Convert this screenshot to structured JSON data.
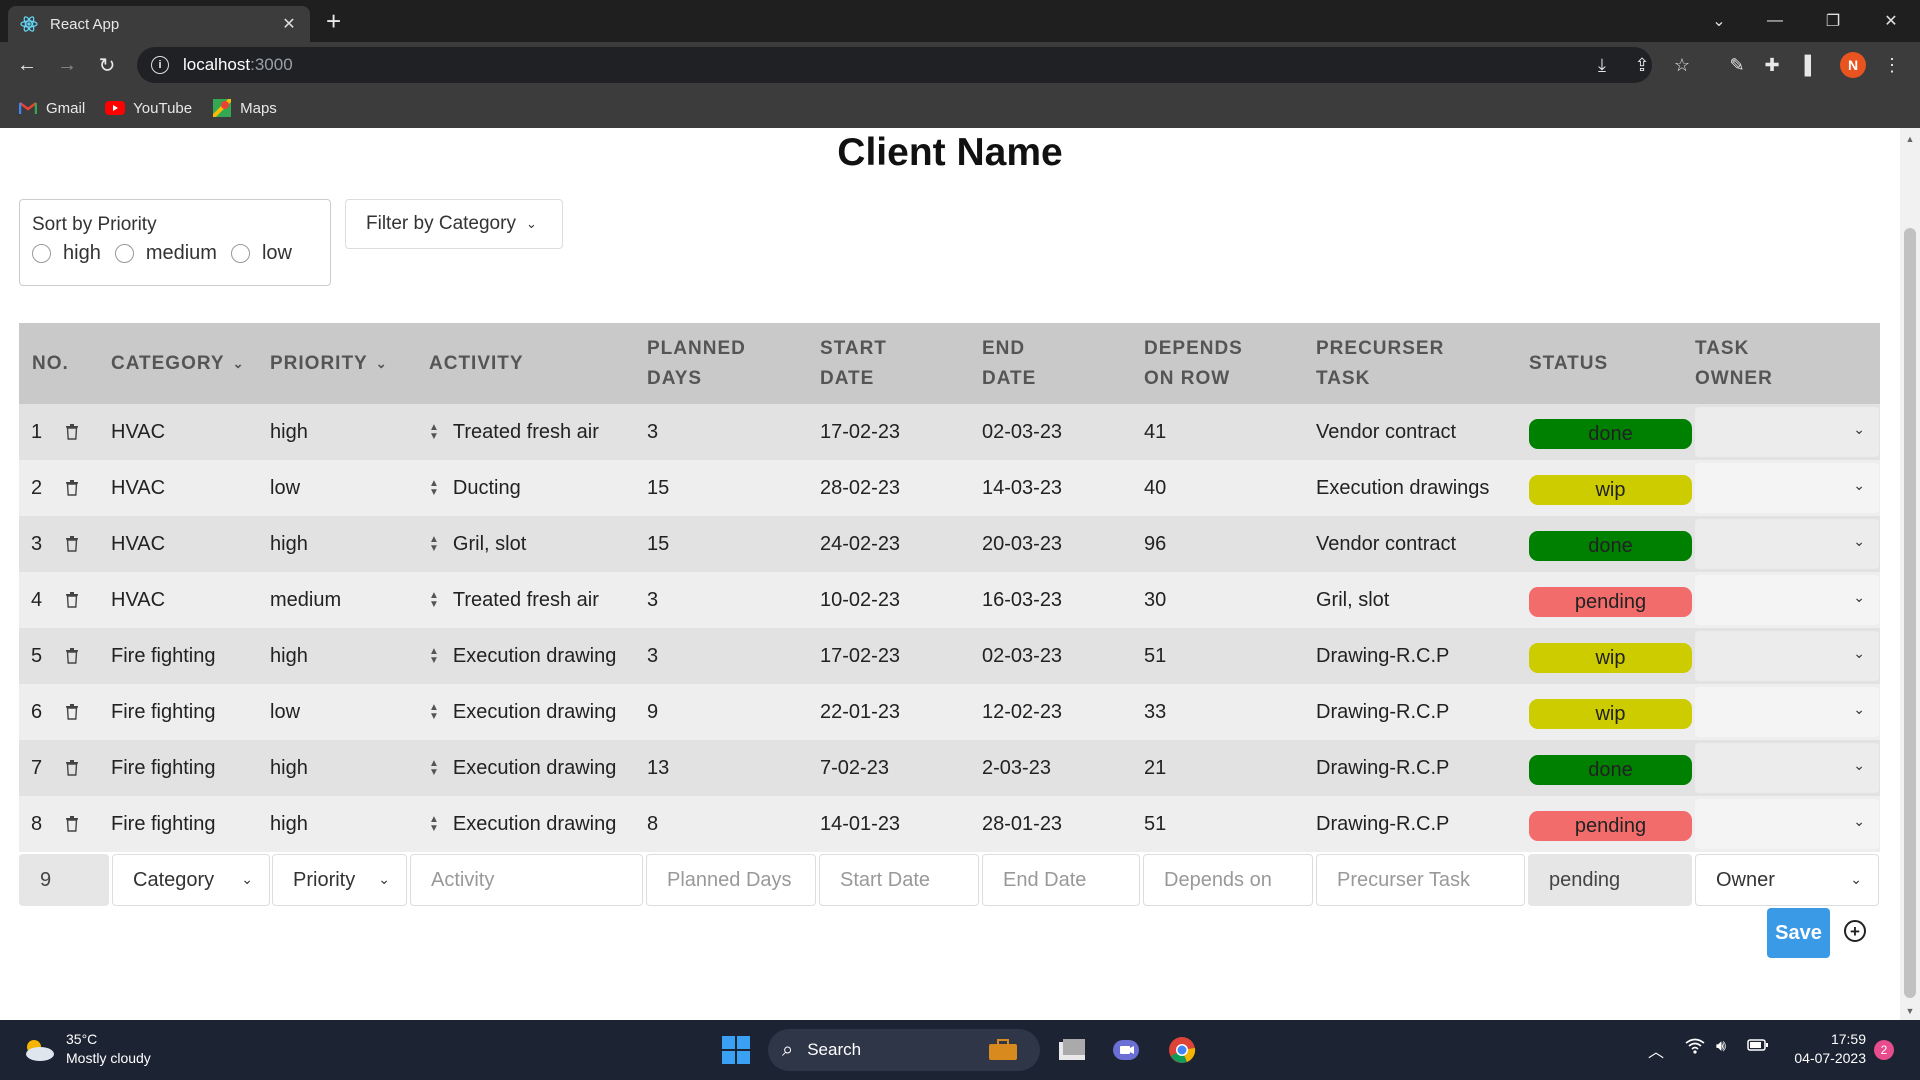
{
  "browser": {
    "tab_title": "React App",
    "url_host": "localhost",
    "url_port": ":3000",
    "bookmarks": [
      {
        "label": "Gmail",
        "icon": "gmail-icon"
      },
      {
        "label": "YouTube",
        "icon": "youtube-icon"
      },
      {
        "label": "Maps",
        "icon": "maps-icon"
      }
    ],
    "profile_initial": "N"
  },
  "page": {
    "title": "Client Name",
    "sort": {
      "label": "Sort by Priority",
      "options": [
        "high",
        "medium",
        "low"
      ]
    },
    "filter_label": "Filter by Category"
  },
  "table": {
    "headers": {
      "no": "NO.",
      "category": "CATEGORY",
      "priority": "PRIORITY",
      "activity": "ACTIVITY",
      "planned_days_1": "PLANNED",
      "planned_days_2": "DAYS",
      "start_date_1": "START",
      "start_date_2": "DATE",
      "end_date_1": "END",
      "end_date_2": "DATE",
      "depends_1": "DEPENDS",
      "depends_2": "ON ROW",
      "precurser_1": "PRECURSER",
      "precurser_2": "TASK",
      "status": "STATUS",
      "owner_1": "TASK",
      "owner_2": "OWNER"
    },
    "rows": [
      {
        "no": "1",
        "category": "HVAC",
        "priority": "high",
        "activity": "Treated fresh air",
        "planned_days": "3",
        "start": "17-02-23",
        "end": "02-03-23",
        "depends": "41",
        "precurser": "Vendor contract",
        "status": "done"
      },
      {
        "no": "2",
        "category": "HVAC",
        "priority": "low",
        "activity": "Ducting",
        "planned_days": "15",
        "start": "28-02-23",
        "end": "14-03-23",
        "depends": "40",
        "precurser": "Execution drawings",
        "status": "wip"
      },
      {
        "no": "3",
        "category": "HVAC",
        "priority": "high",
        "activity": "Gril, slot",
        "planned_days": "15",
        "start": "24-02-23",
        "end": "20-03-23",
        "depends": "96",
        "precurser": "Vendor contract",
        "status": "done"
      },
      {
        "no": "4",
        "category": "HVAC",
        "priority": "medium",
        "activity": "Treated fresh air",
        "planned_days": "3",
        "start": "10-02-23",
        "end": "16-03-23",
        "depends": "30",
        "precurser": "Gril, slot",
        "status": "pending"
      },
      {
        "no": "5",
        "category": "Fire fighting",
        "priority": "high",
        "activity": "Execution drawing",
        "planned_days": "3",
        "start": "17-02-23",
        "end": "02-03-23",
        "depends": "51",
        "precurser": "Drawing-R.C.P",
        "status": "wip"
      },
      {
        "no": "6",
        "category": "Fire fighting",
        "priority": "low",
        "activity": "Execution drawing",
        "planned_days": "9",
        "start": "22-01-23",
        "end": "12-02-23",
        "depends": "33",
        "precurser": "Drawing-R.C.P",
        "status": "wip"
      },
      {
        "no": "7",
        "category": "Fire fighting",
        "priority": "high",
        "activity": "Execution drawing",
        "planned_days": "13",
        "start": "7-02-23",
        "end": "2-03-23",
        "depends": "21",
        "precurser": "Drawing-R.C.P",
        "status": "done"
      },
      {
        "no": "8",
        "category": "Fire fighting",
        "priority": "high",
        "activity": "Execution drawing",
        "planned_days": "8",
        "start": "14-01-23",
        "end": "28-01-23",
        "depends": "51",
        "precurser": "Drawing-R.C.P",
        "status": "pending"
      }
    ],
    "status_colors": {
      "done": "#008000",
      "wip": "#cccc00",
      "pending": "#f26c6c"
    },
    "new_row": {
      "no": "9",
      "category": "Category",
      "priority": "Priority",
      "activity_placeholder": "Activity",
      "planned_days_placeholder": "Planned Days",
      "start_placeholder": "Start Date",
      "end_placeholder": "End Date",
      "depends_placeholder": "Depends on",
      "precurser_placeholder": "Precurser Task",
      "status": "pending",
      "owner": "Owner"
    },
    "save_label": "Save"
  },
  "taskbar": {
    "temperature": "35°C",
    "weather": "Mostly cloudy",
    "search_label": "Search",
    "time": "17:59",
    "date": "04-07-2023",
    "notification_count": "2"
  }
}
